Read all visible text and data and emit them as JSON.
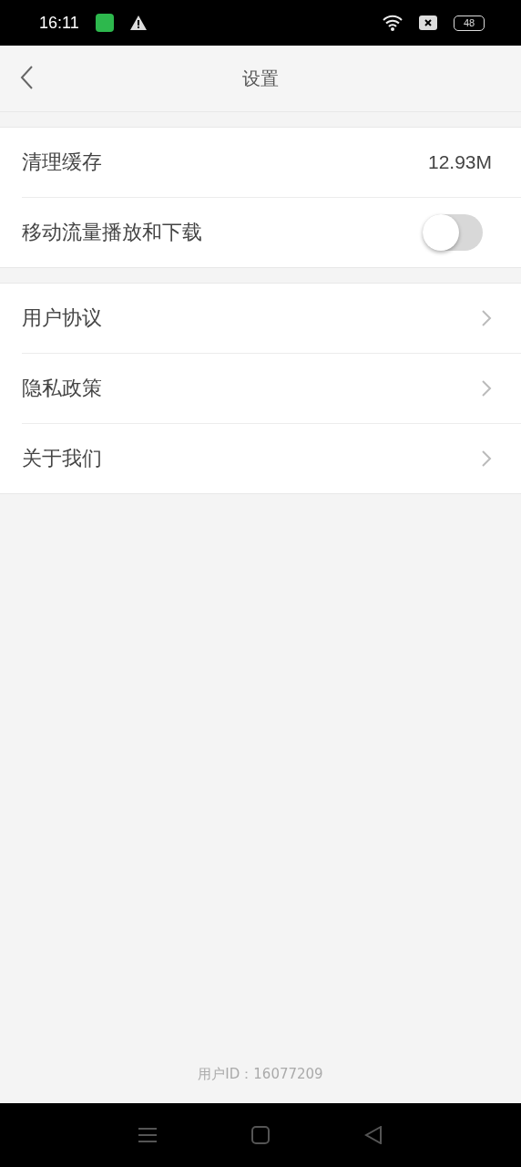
{
  "status_bar": {
    "time": "16:11",
    "battery": "48"
  },
  "header": {
    "title": "设置"
  },
  "groups": [
    {
      "items": [
        {
          "kind": "value",
          "label": "清理缓存",
          "value": "12.93M"
        },
        {
          "kind": "toggle",
          "label": "移动流量播放和下载",
          "on": false
        }
      ]
    },
    {
      "items": [
        {
          "kind": "link",
          "label": "用户协议"
        },
        {
          "kind": "link",
          "label": "隐私政策"
        },
        {
          "kind": "link",
          "label": "关于我们"
        }
      ]
    }
  ],
  "footer": {
    "user_id": "用户ID：16077209"
  }
}
